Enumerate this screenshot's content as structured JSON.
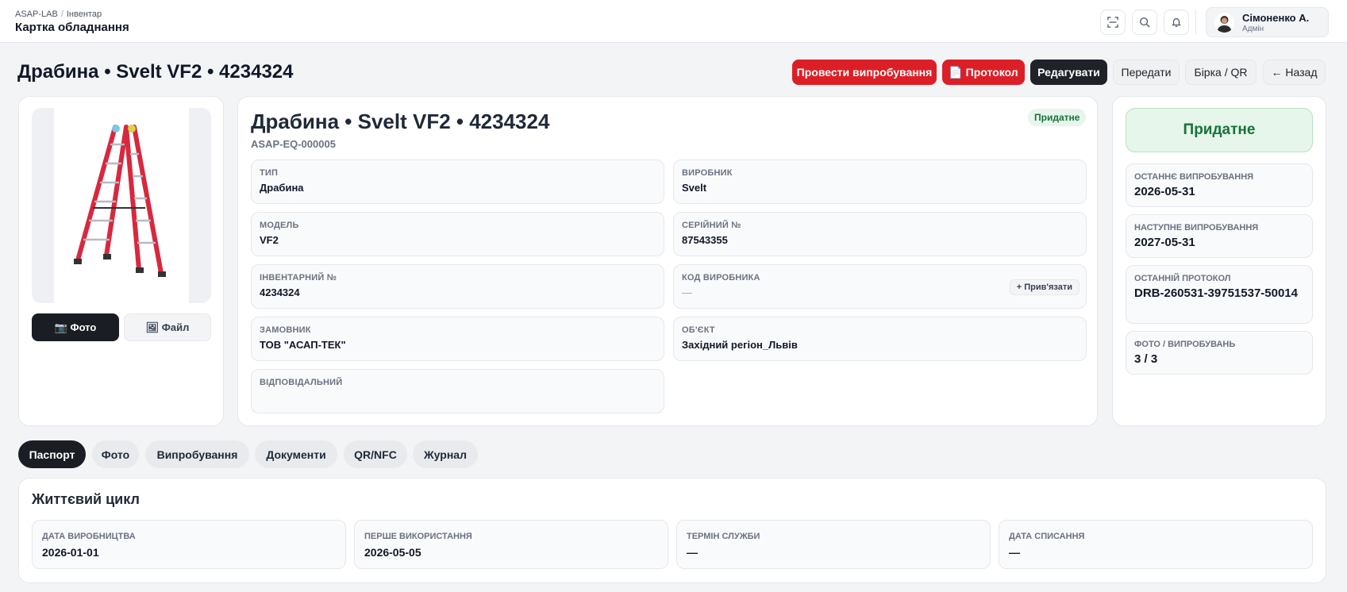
{
  "topbar": {
    "breadcrumb": [
      "ASAP-LAB",
      "Інвентар"
    ],
    "title": "Картка обладнання",
    "user": {
      "name": "Сімоненко А.",
      "role": "Адмін"
    }
  },
  "page": {
    "title": "Драбина • Svelt VF2 • 4234324",
    "actions": {
      "test": "Провести випробування",
      "protocol": "📄 Протокол",
      "edit": "Редагувати",
      "transfer": "Передати",
      "tag": "Бірка / QR",
      "back": "← Назад"
    }
  },
  "photo": {
    "photo_button": "📷 Фото",
    "file_button": "🖼 Файл"
  },
  "equipment": {
    "title": "Драбина • Svelt VF2 • 4234324",
    "code": "ASAP-EQ-000005",
    "status_badge": "Придатне",
    "fields": [
      {
        "label": "ТИП",
        "value": "Драбина"
      },
      {
        "label": "ВИРОБНИК",
        "value": "Svelt"
      },
      {
        "label": "МОДЕЛЬ",
        "value": "VF2"
      },
      {
        "label": "СЕРІЙНИЙ №",
        "value": "87543355"
      },
      {
        "label": "ІНВЕНТАРНИЙ №",
        "value": "4234324"
      },
      {
        "label": "КОД ВИРОБНИКА",
        "value": "—"
      },
      {
        "label": "ЗАМОВНИК",
        "value": "ТОВ \"АСАП-ТЕК\""
      },
      {
        "label": "ОБ'ЄКТ",
        "value": "Західний регіон_Львів"
      },
      {
        "label": "ВІДПОВІДАЛЬНИЙ",
        "value": ""
      }
    ],
    "link_button": "+ Прив'язати"
  },
  "status": {
    "big": "Придатне",
    "stats": [
      {
        "label": "ОСТАННЄ ВИПРОБУВАННЯ",
        "value": "2026-05-31"
      },
      {
        "label": "НАСТУПНЕ ВИПРОБУВАННЯ",
        "value": "2027-05-31"
      },
      {
        "label": "ОСТАННІЙ ПРОТОКОЛ",
        "value": "DRB-260531-39751537-50014"
      },
      {
        "label": "ФОТО / ВИПРОБУВАНЬ",
        "value": "3 / 3"
      }
    ]
  },
  "tabs": [
    "Паспорт",
    "Фото",
    "Випробування",
    "Документи",
    "QR/NFC",
    "Журнал"
  ],
  "lifecycle": {
    "title": "Життєвий цикл",
    "items": [
      {
        "label": "ДАТА ВИРОБНИЦТВА",
        "value": "2026-01-01"
      },
      {
        "label": "ПЕРШЕ ВИКОРИСТАННЯ",
        "value": "2026-05-05"
      },
      {
        "label": "ТЕРМІН СЛУЖБИ",
        "value": "—"
      },
      {
        "label": "ДАТА СПИСАННЯ",
        "value": "—"
      }
    ]
  },
  "colors": {
    "accent_red": "#dc1f26",
    "dark": "#1a1d24",
    "ok_green": "#16733a"
  }
}
